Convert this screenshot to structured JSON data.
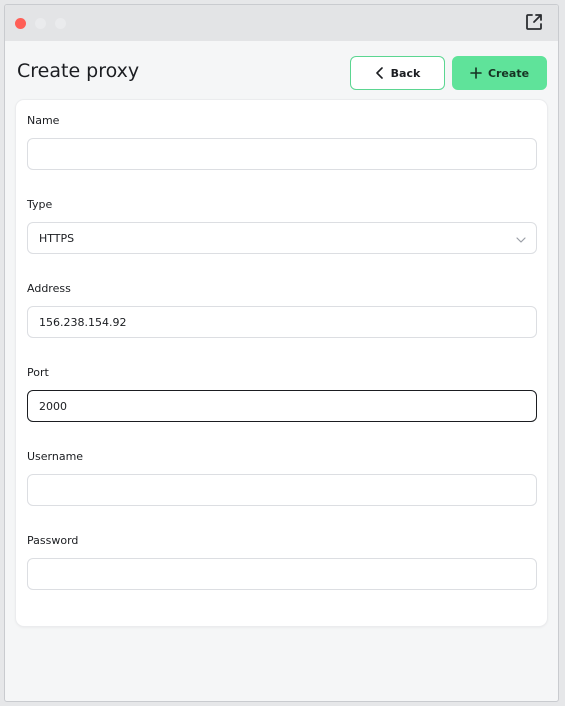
{
  "window": {
    "title_icons": [
      "close-dot",
      "minimize-dot",
      "maximize-dot",
      "popout-icon"
    ]
  },
  "header": {
    "title": "Create proxy",
    "back_label": "Back",
    "create_label": "Create"
  },
  "form": {
    "name": {
      "label": "Name",
      "value": ""
    },
    "type": {
      "label": "Type",
      "value": "HTTPS"
    },
    "address": {
      "label": "Address",
      "value": "156.238.154.92"
    },
    "port": {
      "label": "Port",
      "value": "2000"
    },
    "username": {
      "label": "Username",
      "value": ""
    },
    "password": {
      "label": "Password",
      "value": ""
    }
  },
  "colors": {
    "accent": "#5fe39a",
    "close_dot": "#ff5f57"
  }
}
